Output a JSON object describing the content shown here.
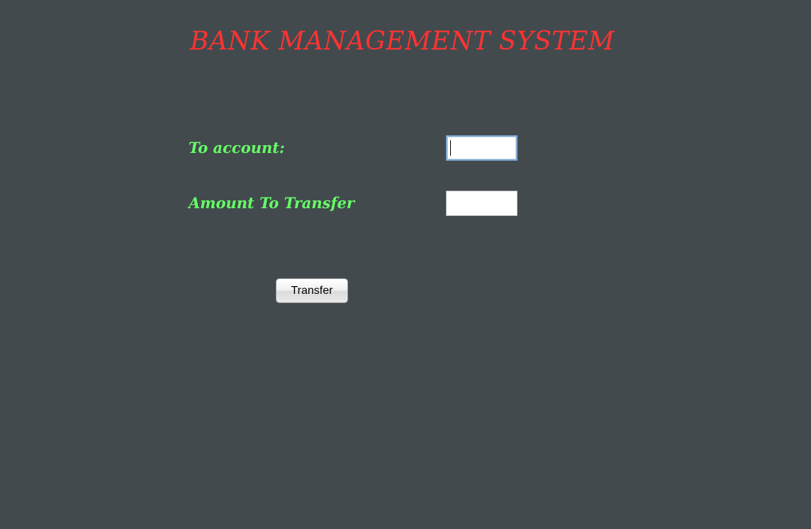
{
  "header": {
    "title": "BANK MANAGEMENT SYSTEM"
  },
  "form": {
    "to_account_label": "To account:",
    "to_account_value": "",
    "amount_label": "Amount To Transfer",
    "amount_value": "",
    "transfer_button_label": "Transfer"
  },
  "colors": {
    "background": "#424a4d",
    "title": "#ff3333",
    "label": "#66ff66"
  }
}
